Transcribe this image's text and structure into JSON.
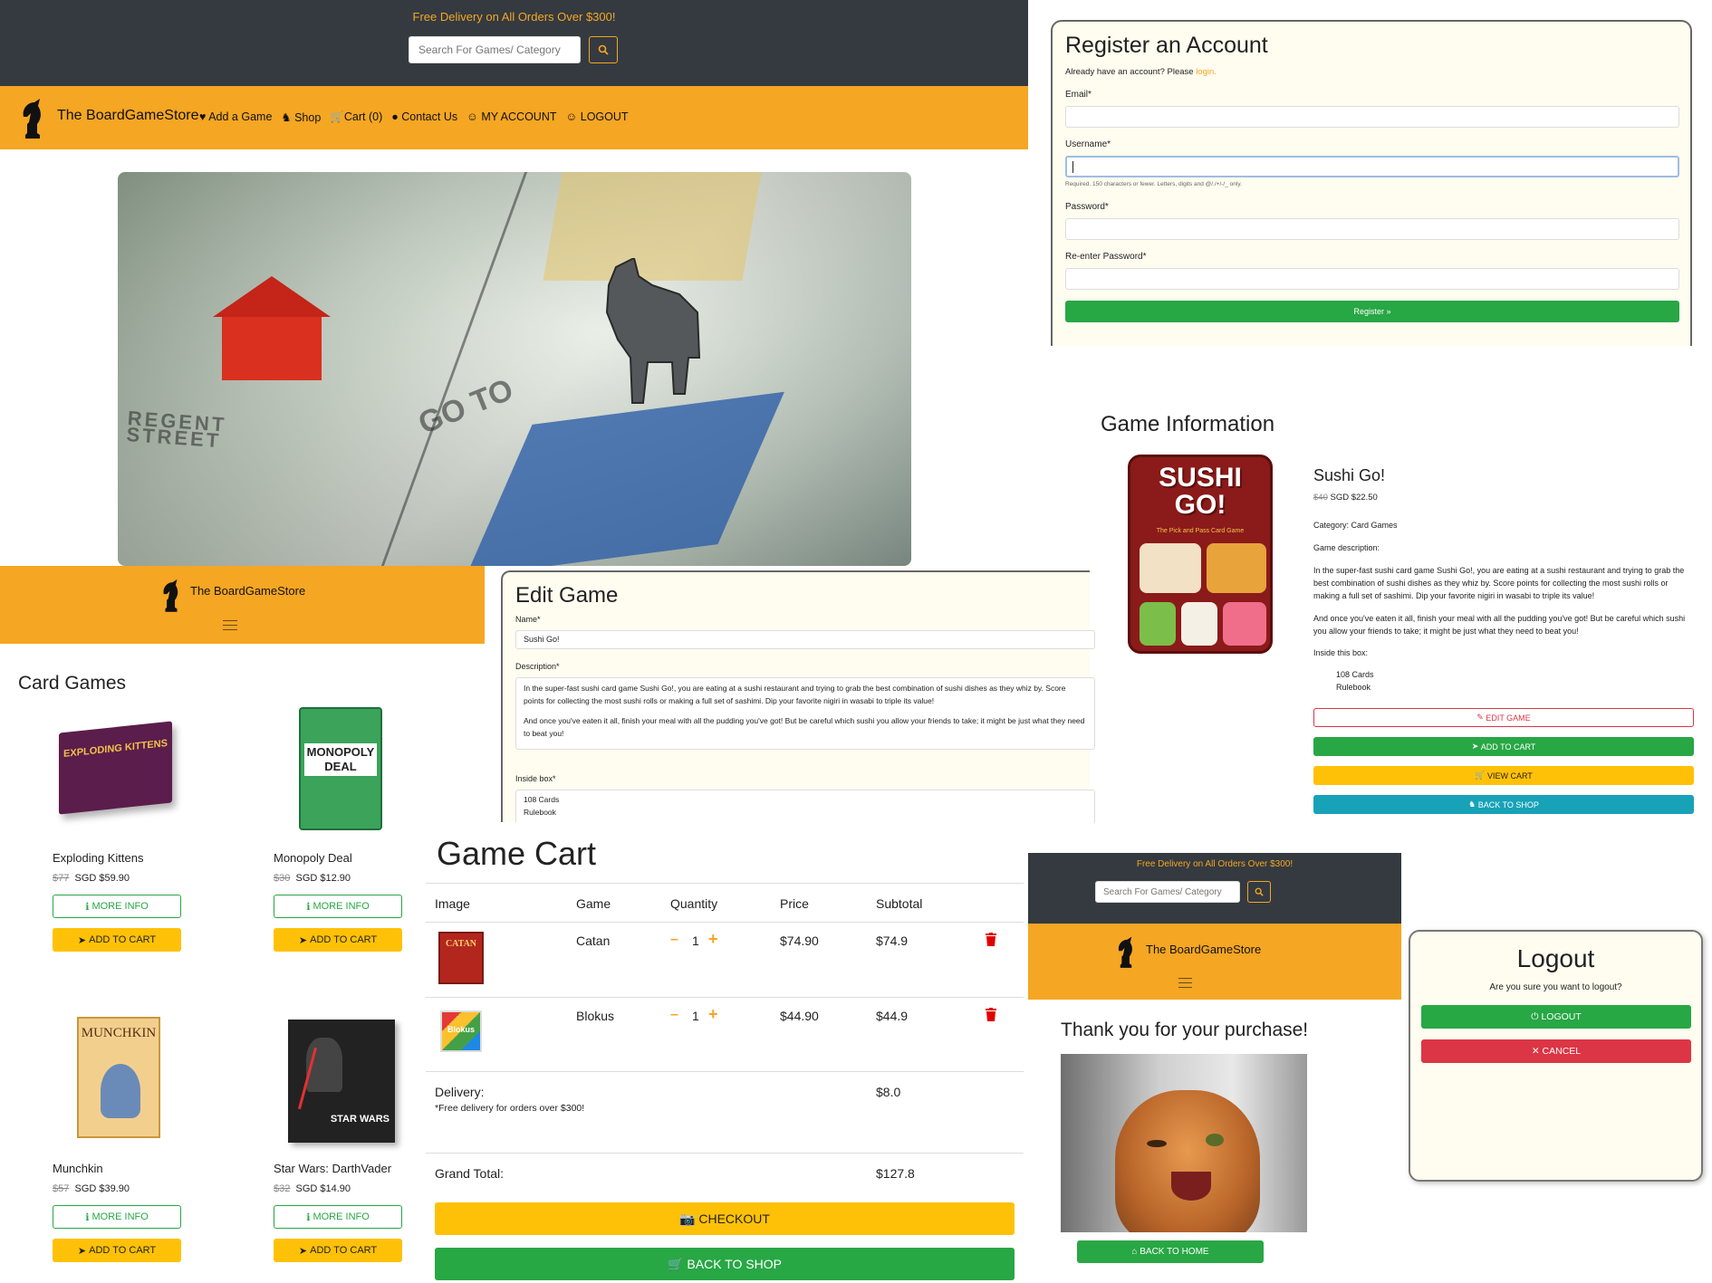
{
  "topbar": {
    "promo": "Free Delivery on All Orders Over $300!",
    "search_placeholder": "Search For Games/ Category"
  },
  "navbar": {
    "brand": "The BoardGameStore",
    "items": [
      "Add a Game",
      "Shop",
      "Cart (0)",
      "Contact Us",
      "MY ACCOUNT",
      "LOGOUT"
    ]
  },
  "register": {
    "title": "Register an Account",
    "have_account": "Already have an account? Please",
    "login_link": "login.",
    "email_label": "Email*",
    "username_label": "Username*",
    "username_help": "Required. 150 characters or fewer. Letters, digits and @/./+/-/_ only.",
    "password_label": "Password*",
    "repassword_label": "Re-enter Password*",
    "submit": "Register »"
  },
  "mobile_nav": {
    "brand": "The BoardGameStore",
    "menu_icon": "hamburger-icon"
  },
  "card_games": {
    "title": "Card Games",
    "more_info": "MORE INFO",
    "add_to_cart": "ADD TO CART",
    "products": [
      {
        "name": "Exploding Kittens",
        "old_price": "$77",
        "price": "SGD $59.90",
        "box_text": "EXPLODING KITTENS"
      },
      {
        "name": "Monopoly Deal",
        "old_price": "$30",
        "price": "SGD $12.90",
        "box_text": "MONOPOLY DEAL"
      },
      {
        "name": "Munchkin",
        "old_price": "$57",
        "price": "SGD $39.90",
        "box_text": "MUNCHKIN"
      },
      {
        "name": "Star Wars: DarthVader",
        "old_price": "$32",
        "price": "SGD $14.90",
        "box_text": "STAR WARS"
      }
    ]
  },
  "edit_game": {
    "title": "Edit Game",
    "name_label": "Name*",
    "name_value": "Sushi Go!",
    "description_label": "Description*",
    "description_p1": "In the super-fast sushi card game Sushi Go!, you are eating at a sushi restaurant and trying to grab the best combination of sushi dishes as they whiz by. Score points for collecting the most sushi rolls or making a full set of sashimi. Dip your favorite nigiri in wasabi to triple its value!",
    "description_p2": "And once you've eaten it all, finish your meal with all the pudding you've got! But be careful which sushi you allow your friends to take; it might be just what they need to beat you!",
    "inside_label": "Inside box*",
    "inside_items": [
      "108 Cards",
      "Rulebook"
    ]
  },
  "game_info": {
    "title": "Game Information",
    "name": "Sushi Go!",
    "old_price": "$40",
    "price": "SGD $22.50",
    "category": "Category: Card Games",
    "description_label": "Game description:",
    "description_p1": "In the super-fast sushi card game Sushi Go!, you are eating at a sushi restaurant and trying to grab the best combination of sushi dishes as they whiz by. Score points for collecting the most sushi rolls or making a full set of sashimi. Dip your favorite nigiri in wasabi to triple its value!",
    "description_p2": "And once you've eaten it all, finish your meal with all the pudding you've got! But be careful which sushi you allow your friends to take; it might be just what they need to beat you!",
    "inside_label": "Inside this box:",
    "inside_items": [
      "108 Cards",
      "Rulebook"
    ],
    "buttons": {
      "edit": "EDIT GAME",
      "add": "ADD TO CART",
      "view": "VIEW CART",
      "back": "BACK TO SHOP"
    },
    "box_title": "SUSHI GO!",
    "box_subtitle": "The Pick and Pass Card Game"
  },
  "cart": {
    "title": "Game Cart",
    "headers": [
      "Image",
      "Game",
      "Quantity",
      "Price",
      "Subtotal"
    ],
    "rows": [
      {
        "game": "Catan",
        "qty": "1",
        "price": "$74.90",
        "subtotal": "$74.9",
        "box_text": "CATAN"
      },
      {
        "game": "Blokus",
        "qty": "1",
        "price": "$44.90",
        "subtotal": "$44.9",
        "box_text": "Blokus"
      }
    ],
    "delivery_label": "Delivery:",
    "delivery_note": "*Free delivery for orders over $300!",
    "delivery_value": "$8.0",
    "grand_total_label": "Grand Total:",
    "grand_total_value": "$127.8",
    "checkout": "CHECKOUT",
    "back": "BACK TO SHOP"
  },
  "thankyou": {
    "promo": "Free Delivery on All Orders Over $300!",
    "search_placeholder": "Search For Games/ Category",
    "brand": "The BoardGameStore",
    "message": "Thank you for your purchase!",
    "button": "BACK TO HOME"
  },
  "logout": {
    "title": "Logout",
    "question": "Are you sure you want to logout?",
    "logout_btn": "LOGOUT",
    "cancel_btn": "CANCEL"
  },
  "hero": {
    "board_text_1": "REGENT STREET",
    "board_text_2": "GO TO"
  },
  "colors": {
    "orange": "#f5a623",
    "dark": "#343a40",
    "green": "#28a745",
    "yellow": "#ffc107",
    "red": "#dc3545",
    "teal": "#17a2b8"
  }
}
